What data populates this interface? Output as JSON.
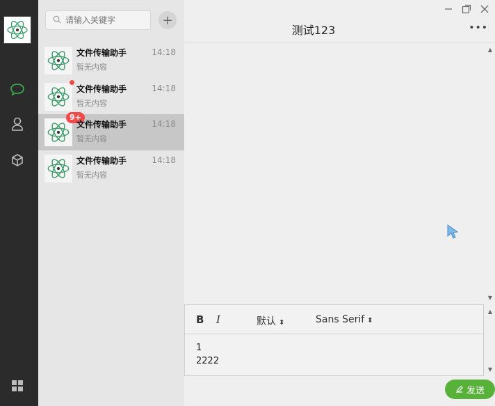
{
  "search": {
    "placeholder": "请输入关键字"
  },
  "conversations": [
    {
      "name": "文件传输助手",
      "time": "14:18",
      "preview": "暂无内容"
    },
    {
      "name": "文件传输助手",
      "time": "14:18",
      "preview": "暂无内容"
    },
    {
      "name": "文件传输助手",
      "time": "14:18",
      "preview": "暂无内容",
      "badge": "9+"
    },
    {
      "name": "文件传输助手",
      "time": "14:18",
      "preview": "暂无内容"
    }
  ],
  "chat": {
    "title": "测试123",
    "more": "•••"
  },
  "editor": {
    "bold": "B",
    "italic": "I",
    "size_value": "默认",
    "font_value": "Sans Serif",
    "content_lines": [
      "1",
      "2222"
    ]
  },
  "send": {
    "label": "发送"
  },
  "colors": {
    "accent": "#58b23a",
    "badge": "#f04a4a",
    "rail": "#2b2b2b",
    "active_row": "#c7c7c7"
  }
}
